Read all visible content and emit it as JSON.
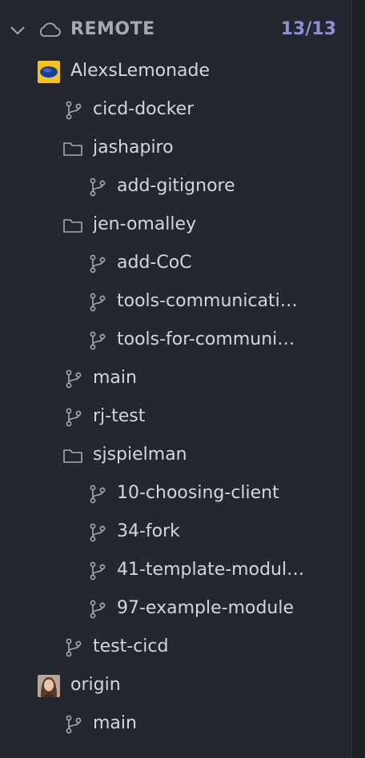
{
  "section": {
    "title": "REMOTE",
    "count": "13/13"
  },
  "remotes": [
    {
      "name": "AlexsLemonade",
      "avatar": "lemonade-logo",
      "items": [
        {
          "type": "branch",
          "label": "cicd-docker"
        },
        {
          "type": "folder",
          "label": "jashapiro",
          "children": [
            {
              "type": "branch",
              "label": "add-gitignore"
            }
          ]
        },
        {
          "type": "folder",
          "label": "jen-omalley",
          "children": [
            {
              "type": "branch",
              "label": "add-CoC"
            },
            {
              "type": "branch",
              "label": "tools-communicati…"
            },
            {
              "type": "branch",
              "label": "tools-for-communi…"
            }
          ]
        },
        {
          "type": "branch",
          "label": "main"
        },
        {
          "type": "branch",
          "label": "rj-test"
        },
        {
          "type": "folder",
          "label": "sjspielman",
          "children": [
            {
              "type": "branch",
              "label": "10-choosing-client"
            },
            {
              "type": "branch",
              "label": "34-fork"
            },
            {
              "type": "branch",
              "label": "41-template-modul…"
            },
            {
              "type": "branch",
              "label": "97-example-module"
            }
          ]
        },
        {
          "type": "branch",
          "label": "test-cicd"
        }
      ]
    },
    {
      "name": "origin",
      "avatar": "user-photo",
      "items": [
        {
          "type": "branch",
          "label": "main"
        }
      ]
    }
  ],
  "colors": {
    "background": "#252730",
    "text": "#d4d6dc",
    "muted": "#a6a9b2",
    "accent": "#8b93d6"
  }
}
